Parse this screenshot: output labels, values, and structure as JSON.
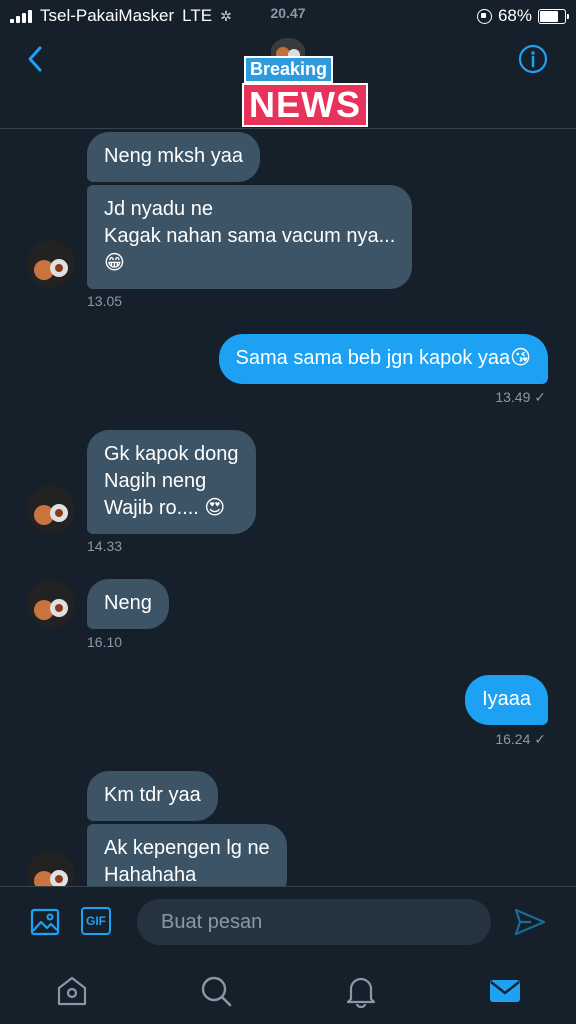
{
  "status_bar": {
    "carrier": "Tsel-PakaiMasker",
    "network": "LTE",
    "time": "20.47",
    "battery": "68%"
  },
  "header": {
    "logo_top": "Breaking",
    "logo_bottom": "NEWS"
  },
  "messages": [
    {
      "id": "m1",
      "side": "in",
      "text": "Neng mksh yaa"
    },
    {
      "id": "m2",
      "side": "in",
      "text": "Jd nyadu ne\nKagak nahan sama vacum nya...\n😁",
      "time": "13.05"
    },
    {
      "id": "m3",
      "side": "out",
      "text": "Sama sama beb jgn kapok yaa😘",
      "time": "13.49 ✓"
    },
    {
      "id": "m4",
      "side": "in",
      "text": "Gk kapok dong\nNagih neng\nWajib ro.... 😍",
      "time": "14.33"
    },
    {
      "id": "m5",
      "side": "in",
      "text": "Neng",
      "time": "16.10"
    },
    {
      "id": "m6",
      "side": "out",
      "text": "Iyaaa",
      "time": "16.24 ✓"
    },
    {
      "id": "m7",
      "side": "in",
      "text": "Km tdr yaa"
    },
    {
      "id": "m8",
      "side": "in",
      "text": "Ak kepengen lg ne\nHahahaha"
    }
  ],
  "composer": {
    "placeholder": "Buat pesan",
    "gif_label": "GIF"
  },
  "colors": {
    "background": "#15202b",
    "incoming_bubble": "#3d5466",
    "outgoing_bubble": "#1da1f2",
    "accent": "#1da1f2",
    "muted": "#8899a6"
  },
  "icons": [
    "back-arrow-icon",
    "info-icon",
    "image-icon",
    "gif-icon",
    "send-icon",
    "home-icon",
    "search-icon",
    "notifications-icon",
    "messages-icon"
  ]
}
